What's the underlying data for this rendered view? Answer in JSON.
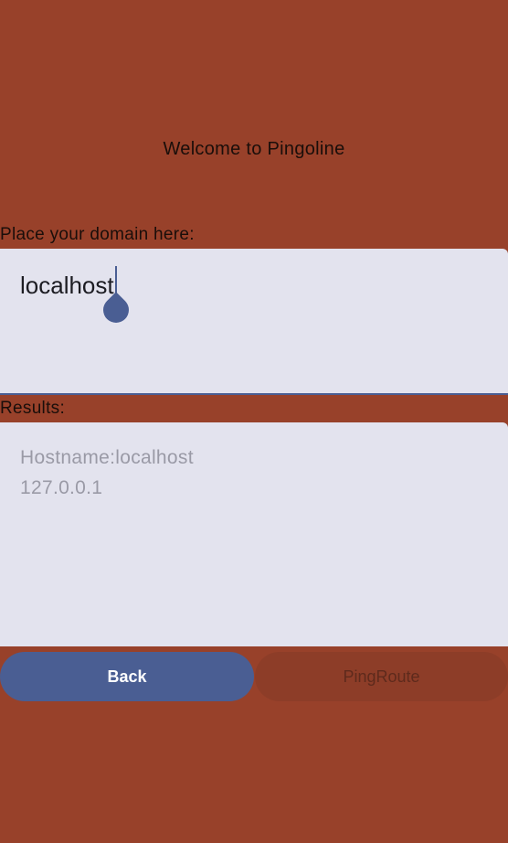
{
  "app": {
    "title": "Welcome to Pingoline"
  },
  "domain": {
    "label": "Place your domain here:",
    "value": "localhost"
  },
  "results": {
    "label": "Results:",
    "lines": [
      "Hostname:localhost",
      "127.0.0.1"
    ]
  },
  "buttons": {
    "back": "Back",
    "pingroute": "PingRoute"
  },
  "colors": {
    "background": "#98412a",
    "field": "#e3e3ee",
    "accent": "#4a5e93",
    "disabled_button": "#8d3d28"
  }
}
